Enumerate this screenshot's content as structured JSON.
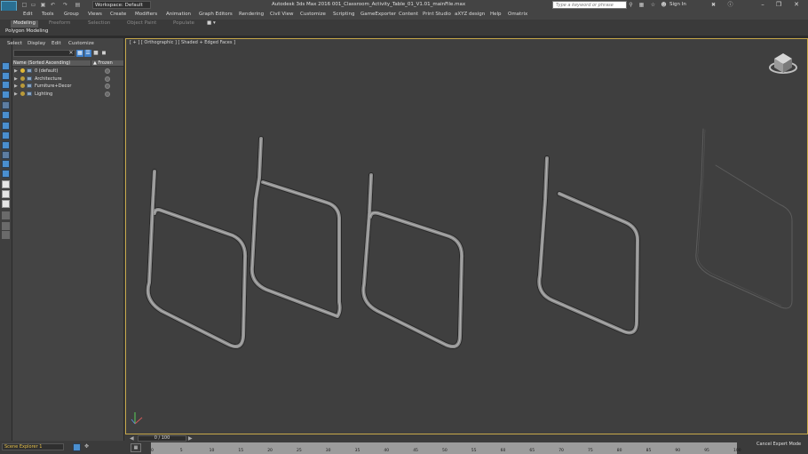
{
  "app": {
    "icon_label": "MAX",
    "workspace": "Workspace: Default",
    "title": "Autodesk 3ds Max 2016     001_Classroom_Activity_Table_01_V1.01_mainFile.max",
    "search_placeholder": "Type a keyword or phrase",
    "signin": "Sign In"
  },
  "menu": [
    "Edit",
    "Tools",
    "Group",
    "Views",
    "Create",
    "Modifiers",
    "Animation",
    "Graph Editors",
    "Rendering",
    "Civil View",
    "Customize",
    "Scripting",
    "GameExporter",
    "Content",
    "Print Studio",
    "aXYZ design",
    "Help",
    "Omatrix"
  ],
  "ribbon": {
    "tabs": [
      {
        "label": "Modeling",
        "active": true
      },
      {
        "label": "Freeform",
        "active": false
      },
      {
        "label": "Selection",
        "active": false
      },
      {
        "label": "Object Paint",
        "active": false
      },
      {
        "label": "Populate",
        "active": false
      }
    ],
    "extra": "■ ▾",
    "sub": "Polygon Modeling"
  },
  "scene_explorer": {
    "menu": [
      "Select",
      "Display",
      "Edit",
      "Customize"
    ],
    "col_name": "Name (Sorted Ascending)",
    "col_frozen": "▲ Frozen",
    "rows": [
      {
        "label": "0 (default)"
      },
      {
        "label": "Architecture"
      },
      {
        "label": "Furniture+Decor"
      },
      {
        "label": "Lighting"
      }
    ],
    "footer": "Scene Explorer 1"
  },
  "viewport": {
    "label": "[ + ] [ Orthographic ] [ Shaded + Edged Faces ]"
  },
  "timeline": {
    "frame": "0 / 100",
    "ticks": [
      "0",
      "5",
      "10",
      "15",
      "20",
      "25",
      "30",
      "35",
      "40",
      "45",
      "50",
      "55",
      "60",
      "65",
      "70",
      "75",
      "80",
      "85",
      "90",
      "95",
      "100"
    ],
    "cancel": "Cancel Expert Mode"
  },
  "colors": {
    "viewport_border": "#c8a94a",
    "accent": "#3d7ec8",
    "tube": "#8a8a8a"
  }
}
